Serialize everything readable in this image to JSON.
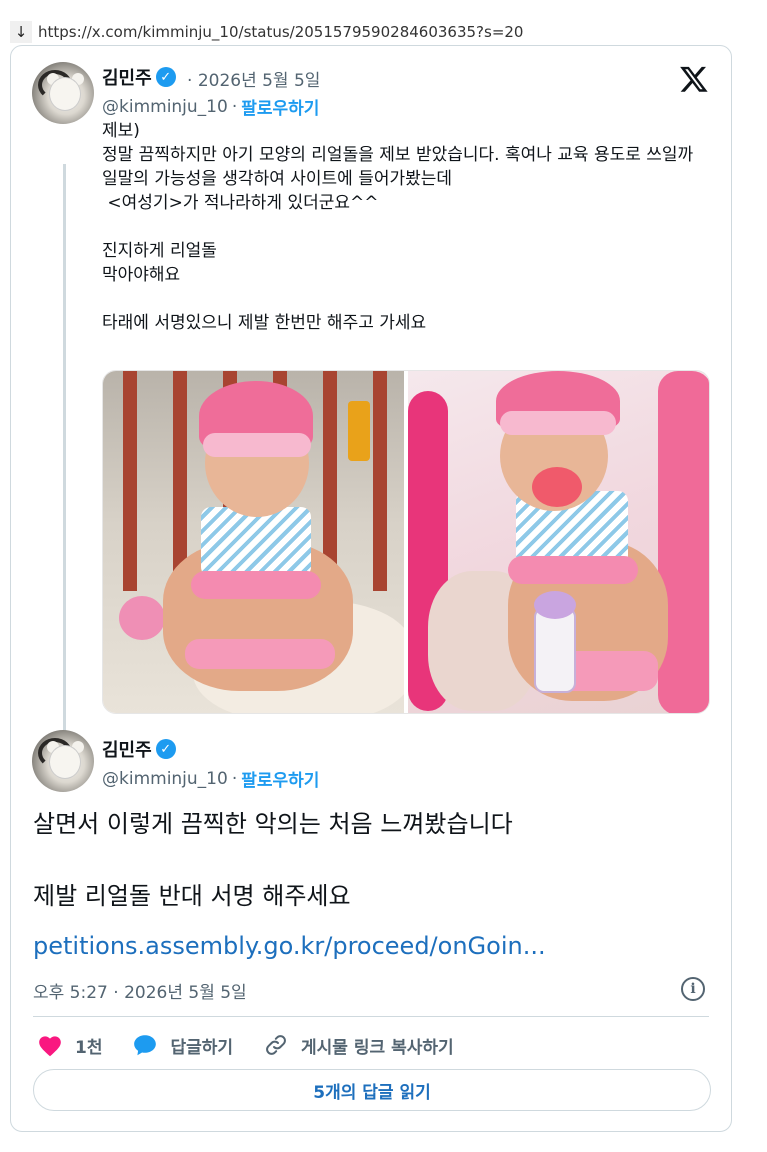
{
  "browser": {
    "download_arrow": "↓",
    "url": "https://x.com/kimminju_10/status/2051579590284603635?s=20"
  },
  "tweet1": {
    "author_name": "김민주",
    "dot": "·",
    "date": "2026년 5월 5일",
    "handle": "@kimminju_10",
    "follow_label": "팔로우하기",
    "text": "제보)\n정말 끔찍하지만 아기 모양의 리얼돌을 제보 받았습니다. 혹여나 교육 용도로 쓰일까 일말의 가능성을 생각하여 사이트에 들어가봤는데\n <여성기>가 적나라하게 있더군요^^\n\n진지하게 리얼돌\n막아야해요\n\n타래에 서명있으니 제발 한번만 해주고 가세요"
  },
  "tweet2": {
    "author_name": "김민주",
    "handle": "@kimminju_10",
    "follow_label": "팔로우하기",
    "text": "살면서 이렇게 끔찍한 악의는 처음 느껴봤습니다\n\n제발 리얼돌 반대 서명 해주세요",
    "link": "petitions.assembly.go.kr/proceed/onGoin...",
    "timestamp": "오후 5:27 · 2026년 5월 5일"
  },
  "actions": {
    "like_count": "1천",
    "reply_label": "답글하기",
    "copy_link_label": "게시물 링크 복사하기"
  },
  "read_replies_label": "5개의 답글 읽기",
  "colors": {
    "accent": "#1d9bf0",
    "link": "#1d6fbd",
    "like": "#f91880",
    "muted": "#536471"
  }
}
